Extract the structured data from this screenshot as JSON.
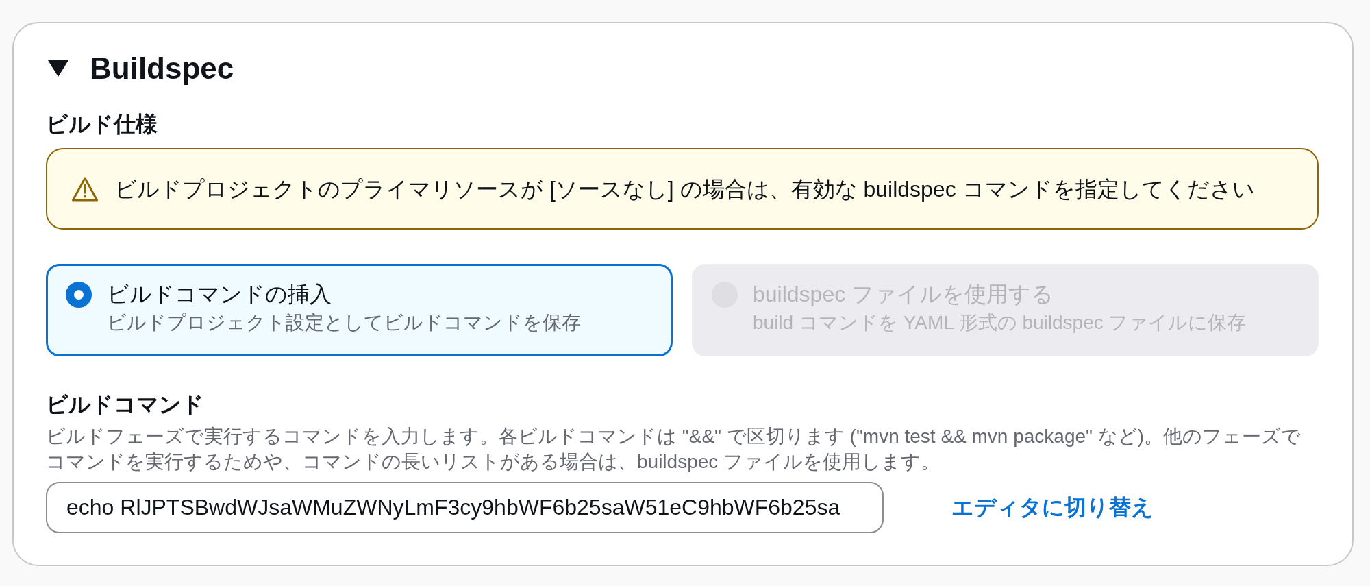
{
  "section": {
    "title": "Buildspec",
    "expanded": true
  },
  "build_spec": {
    "label": "ビルド仕様",
    "alert": {
      "kind": "warning",
      "text": "ビルドプロジェクトのプライマリソースが [ソースなし] の場合は、有効な buildspec コマンドを指定してください"
    },
    "options": [
      {
        "title": "ビルドコマンドの挿入",
        "description": "ビルドプロジェクト設定としてビルドコマンドを保存",
        "selected": true,
        "disabled": false
      },
      {
        "title": "buildspec ファイルを使用する",
        "description": "build コマンドを YAML 形式の buildspec ファイルに保存",
        "selected": false,
        "disabled": true
      }
    ]
  },
  "build_commands": {
    "label": "ビルドコマンド",
    "description": "ビルドフェーズで実行するコマンドを入力します。各ビルドコマンドは \"&&\" で区切ります (\"mvn test && mvn package\" など)。他のフェーズでコマンドを実行するためや、コマンドの長いリストがある場合は、buildspec ファイルを使用します。",
    "value": "echo RlJPTSBwdWJsaWMuZWNyLmF3cy9hbWF6b25saW51eC9hbWF6b25sa",
    "link": "エディタに切り替え"
  }
}
